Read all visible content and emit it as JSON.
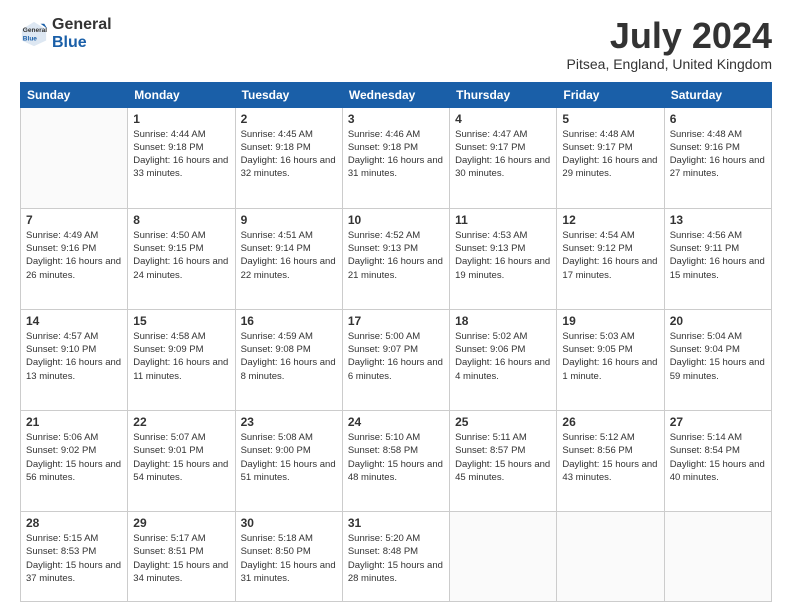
{
  "logo": {
    "general": "General",
    "blue": "Blue"
  },
  "header": {
    "title": "July 2024",
    "subtitle": "Pitsea, England, United Kingdom"
  },
  "days_of_week": [
    "Sunday",
    "Monday",
    "Tuesday",
    "Wednesday",
    "Thursday",
    "Friday",
    "Saturday"
  ],
  "weeks": [
    [
      {
        "number": "",
        "sunrise": "",
        "sunset": "",
        "daylight": ""
      },
      {
        "number": "1",
        "sunrise": "Sunrise: 4:44 AM",
        "sunset": "Sunset: 9:18 PM",
        "daylight": "Daylight: 16 hours and 33 minutes."
      },
      {
        "number": "2",
        "sunrise": "Sunrise: 4:45 AM",
        "sunset": "Sunset: 9:18 PM",
        "daylight": "Daylight: 16 hours and 32 minutes."
      },
      {
        "number": "3",
        "sunrise": "Sunrise: 4:46 AM",
        "sunset": "Sunset: 9:18 PM",
        "daylight": "Daylight: 16 hours and 31 minutes."
      },
      {
        "number": "4",
        "sunrise": "Sunrise: 4:47 AM",
        "sunset": "Sunset: 9:17 PM",
        "daylight": "Daylight: 16 hours and 30 minutes."
      },
      {
        "number": "5",
        "sunrise": "Sunrise: 4:48 AM",
        "sunset": "Sunset: 9:17 PM",
        "daylight": "Daylight: 16 hours and 29 minutes."
      },
      {
        "number": "6",
        "sunrise": "Sunrise: 4:48 AM",
        "sunset": "Sunset: 9:16 PM",
        "daylight": "Daylight: 16 hours and 27 minutes."
      }
    ],
    [
      {
        "number": "7",
        "sunrise": "Sunrise: 4:49 AM",
        "sunset": "Sunset: 9:16 PM",
        "daylight": "Daylight: 16 hours and 26 minutes."
      },
      {
        "number": "8",
        "sunrise": "Sunrise: 4:50 AM",
        "sunset": "Sunset: 9:15 PM",
        "daylight": "Daylight: 16 hours and 24 minutes."
      },
      {
        "number": "9",
        "sunrise": "Sunrise: 4:51 AM",
        "sunset": "Sunset: 9:14 PM",
        "daylight": "Daylight: 16 hours and 22 minutes."
      },
      {
        "number": "10",
        "sunrise": "Sunrise: 4:52 AM",
        "sunset": "Sunset: 9:13 PM",
        "daylight": "Daylight: 16 hours and 21 minutes."
      },
      {
        "number": "11",
        "sunrise": "Sunrise: 4:53 AM",
        "sunset": "Sunset: 9:13 PM",
        "daylight": "Daylight: 16 hours and 19 minutes."
      },
      {
        "number": "12",
        "sunrise": "Sunrise: 4:54 AM",
        "sunset": "Sunset: 9:12 PM",
        "daylight": "Daylight: 16 hours and 17 minutes."
      },
      {
        "number": "13",
        "sunrise": "Sunrise: 4:56 AM",
        "sunset": "Sunset: 9:11 PM",
        "daylight": "Daylight: 16 hours and 15 minutes."
      }
    ],
    [
      {
        "number": "14",
        "sunrise": "Sunrise: 4:57 AM",
        "sunset": "Sunset: 9:10 PM",
        "daylight": "Daylight: 16 hours and 13 minutes."
      },
      {
        "number": "15",
        "sunrise": "Sunrise: 4:58 AM",
        "sunset": "Sunset: 9:09 PM",
        "daylight": "Daylight: 16 hours and 11 minutes."
      },
      {
        "number": "16",
        "sunrise": "Sunrise: 4:59 AM",
        "sunset": "Sunset: 9:08 PM",
        "daylight": "Daylight: 16 hours and 8 minutes."
      },
      {
        "number": "17",
        "sunrise": "Sunrise: 5:00 AM",
        "sunset": "Sunset: 9:07 PM",
        "daylight": "Daylight: 16 hours and 6 minutes."
      },
      {
        "number": "18",
        "sunrise": "Sunrise: 5:02 AM",
        "sunset": "Sunset: 9:06 PM",
        "daylight": "Daylight: 16 hours and 4 minutes."
      },
      {
        "number": "19",
        "sunrise": "Sunrise: 5:03 AM",
        "sunset": "Sunset: 9:05 PM",
        "daylight": "Daylight: 16 hours and 1 minute."
      },
      {
        "number": "20",
        "sunrise": "Sunrise: 5:04 AM",
        "sunset": "Sunset: 9:04 PM",
        "daylight": "Daylight: 15 hours and 59 minutes."
      }
    ],
    [
      {
        "number": "21",
        "sunrise": "Sunrise: 5:06 AM",
        "sunset": "Sunset: 9:02 PM",
        "daylight": "Daylight: 15 hours and 56 minutes."
      },
      {
        "number": "22",
        "sunrise": "Sunrise: 5:07 AM",
        "sunset": "Sunset: 9:01 PM",
        "daylight": "Daylight: 15 hours and 54 minutes."
      },
      {
        "number": "23",
        "sunrise": "Sunrise: 5:08 AM",
        "sunset": "Sunset: 9:00 PM",
        "daylight": "Daylight: 15 hours and 51 minutes."
      },
      {
        "number": "24",
        "sunrise": "Sunrise: 5:10 AM",
        "sunset": "Sunset: 8:58 PM",
        "daylight": "Daylight: 15 hours and 48 minutes."
      },
      {
        "number": "25",
        "sunrise": "Sunrise: 5:11 AM",
        "sunset": "Sunset: 8:57 PM",
        "daylight": "Daylight: 15 hours and 45 minutes."
      },
      {
        "number": "26",
        "sunrise": "Sunrise: 5:12 AM",
        "sunset": "Sunset: 8:56 PM",
        "daylight": "Daylight: 15 hours and 43 minutes."
      },
      {
        "number": "27",
        "sunrise": "Sunrise: 5:14 AM",
        "sunset": "Sunset: 8:54 PM",
        "daylight": "Daylight: 15 hours and 40 minutes."
      }
    ],
    [
      {
        "number": "28",
        "sunrise": "Sunrise: 5:15 AM",
        "sunset": "Sunset: 8:53 PM",
        "daylight": "Daylight: 15 hours and 37 minutes."
      },
      {
        "number": "29",
        "sunrise": "Sunrise: 5:17 AM",
        "sunset": "Sunset: 8:51 PM",
        "daylight": "Daylight: 15 hours and 34 minutes."
      },
      {
        "number": "30",
        "sunrise": "Sunrise: 5:18 AM",
        "sunset": "Sunset: 8:50 PM",
        "daylight": "Daylight: 15 hours and 31 minutes."
      },
      {
        "number": "31",
        "sunrise": "Sunrise: 5:20 AM",
        "sunset": "Sunset: 8:48 PM",
        "daylight": "Daylight: 15 hours and 28 minutes."
      },
      {
        "number": "",
        "sunrise": "",
        "sunset": "",
        "daylight": ""
      },
      {
        "number": "",
        "sunrise": "",
        "sunset": "",
        "daylight": ""
      },
      {
        "number": "",
        "sunrise": "",
        "sunset": "",
        "daylight": ""
      }
    ]
  ]
}
